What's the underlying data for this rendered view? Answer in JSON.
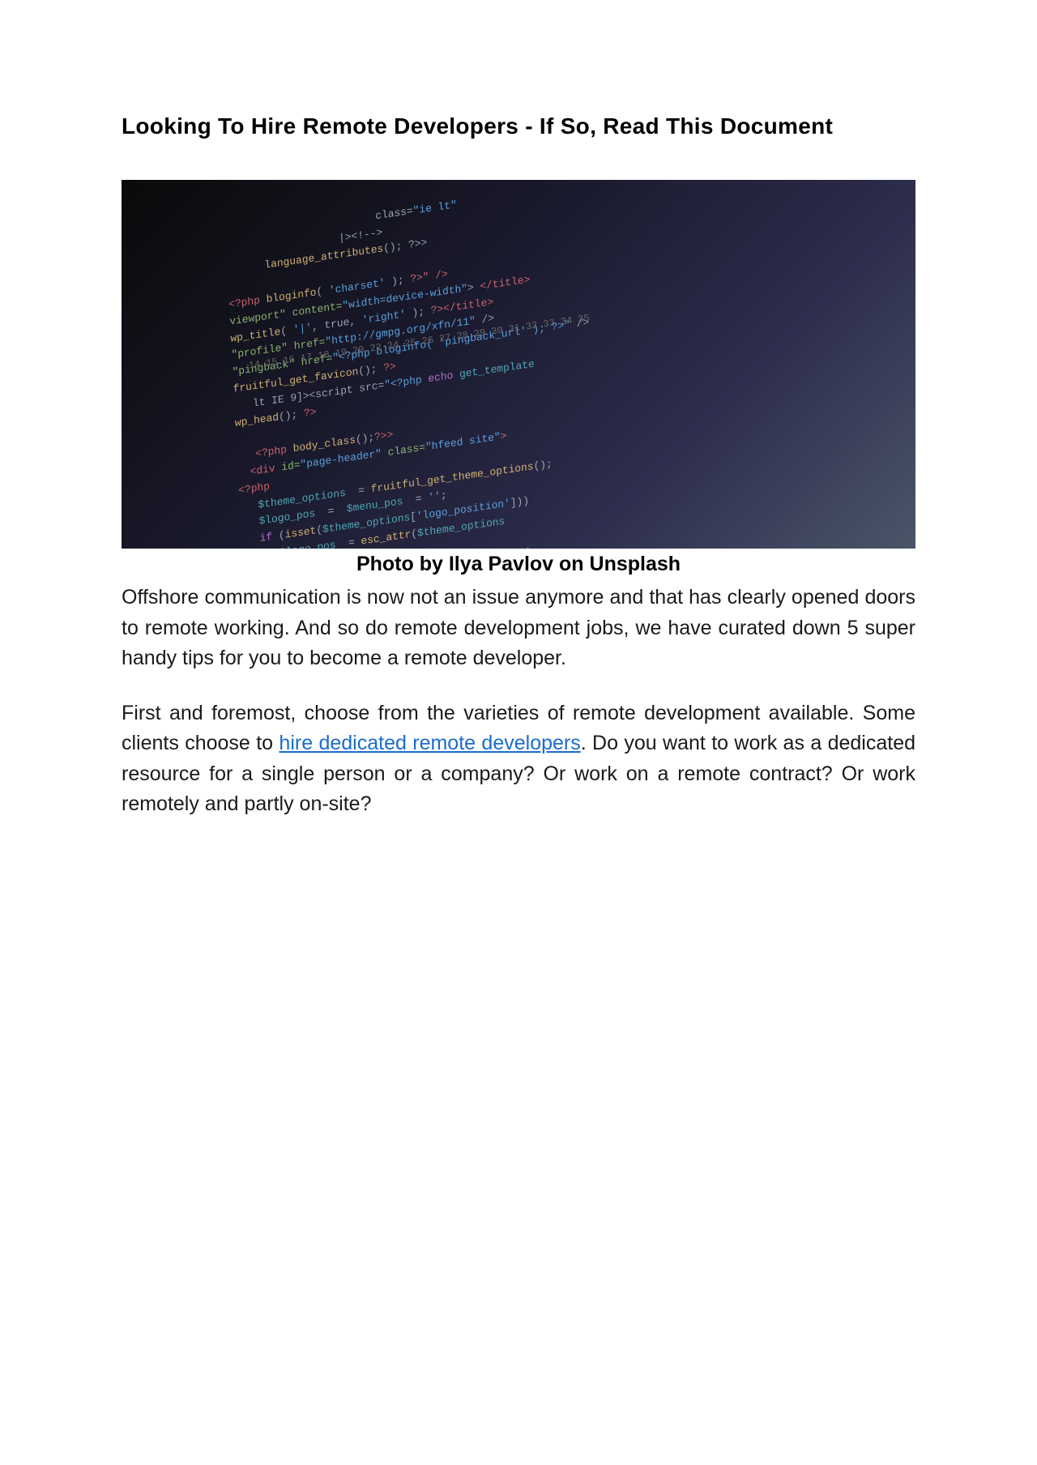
{
  "title": "Looking To Hire Remote Developers  - If So, Read This Document",
  "image": {
    "caption": "Photo by Ilya Pavlov on Unsplash",
    "alt": "Code on a dark screen"
  },
  "paragraphs": {
    "p1": "Offshore communication is now not an issue anymore and that has clearly opened doors to remote working. And so do remote development jobs, we have curated down 5 super handy tips for you to become a remote developer.",
    "p2_before": "First and foremost, choose from the varieties of remote development available. Some clients choose to ",
    "link_text": "hire dedicated remote developers",
    "p2_after": ". Do you want to work as a dedicated resource for a single person or a company? Or work on a remote contract? Or work remotely and partly on-site?"
  }
}
